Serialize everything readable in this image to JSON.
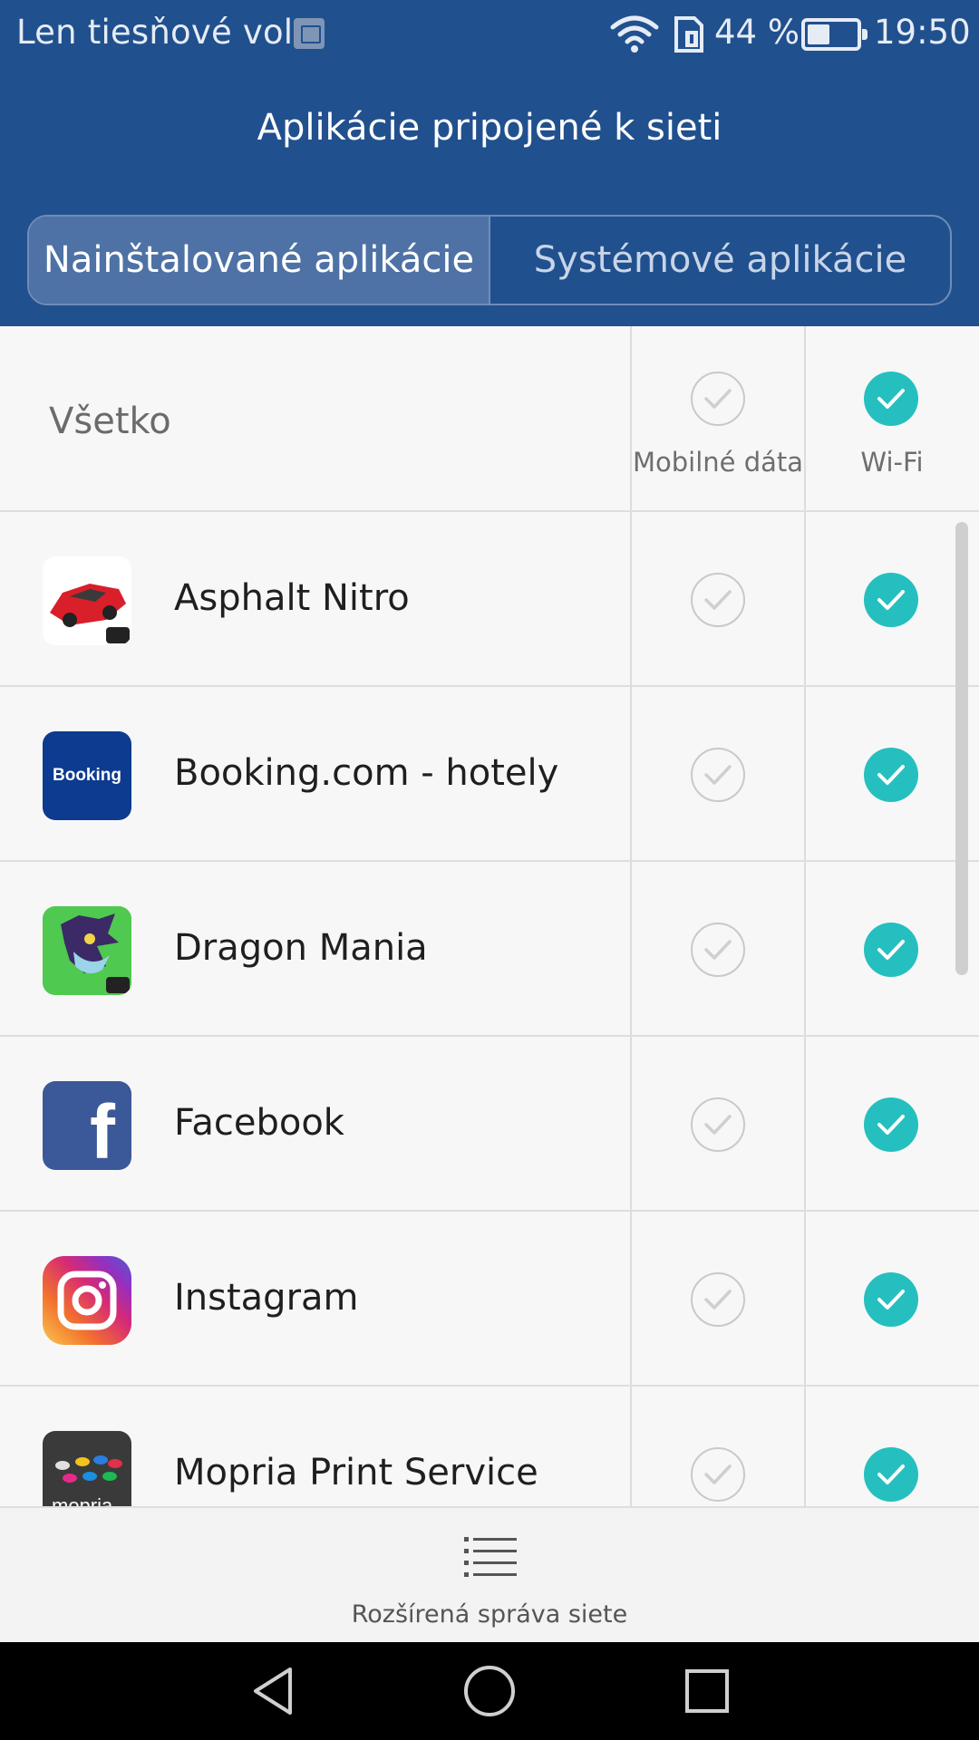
{
  "status_bar": {
    "carrier": "Len tiesňové vol.",
    "icons": [
      "image-notification-icon",
      "wifi-icon",
      "sim-icon",
      "battery-icon"
    ],
    "battery_percent": "44 %",
    "time": "19:50"
  },
  "header": {
    "title": "Aplikácie pripojené k sieti",
    "color": "#21508e"
  },
  "tabs": [
    {
      "label": "Nainštalované aplikácie",
      "active": true
    },
    {
      "label": "Systémové aplikácie",
      "active": false
    }
  ],
  "all_row": {
    "label": "Všetko",
    "mobile_label": "Mobilné dáta",
    "wifi_label": "Wi-Fi",
    "mobile_on": false,
    "wifi_on": true
  },
  "apps": [
    {
      "name": "Asphalt Nitro",
      "icon": "asphalt-nitro-icon",
      "mobile": false,
      "wifi": true
    },
    {
      "name": "Booking.com - hotely",
      "icon": "booking-icon",
      "icon_text": "Booking",
      "mobile": false,
      "wifi": true
    },
    {
      "name": "Dragon Mania",
      "icon": "dragon-mania-icon",
      "mobile": false,
      "wifi": true
    },
    {
      "name": "Facebook",
      "icon": "facebook-icon",
      "icon_text": "f",
      "mobile": false,
      "wifi": true
    },
    {
      "name": "Instagram",
      "icon": "instagram-icon",
      "mobile": false,
      "wifi": true
    },
    {
      "name": "Mopria Print Service",
      "icon": "mopria-icon",
      "icon_text": "mopria",
      "mobile": false,
      "wifi": true
    }
  ],
  "bottom_bar": {
    "label": "Rozšírená správa siete",
    "icon": "list-menu-icon"
  },
  "nav_bar": {
    "buttons": [
      "back-icon",
      "home-icon",
      "recents-icon"
    ]
  },
  "colors": {
    "accent_checked": "#26bfbf",
    "unchecked_ring": "#c9c9c9"
  }
}
